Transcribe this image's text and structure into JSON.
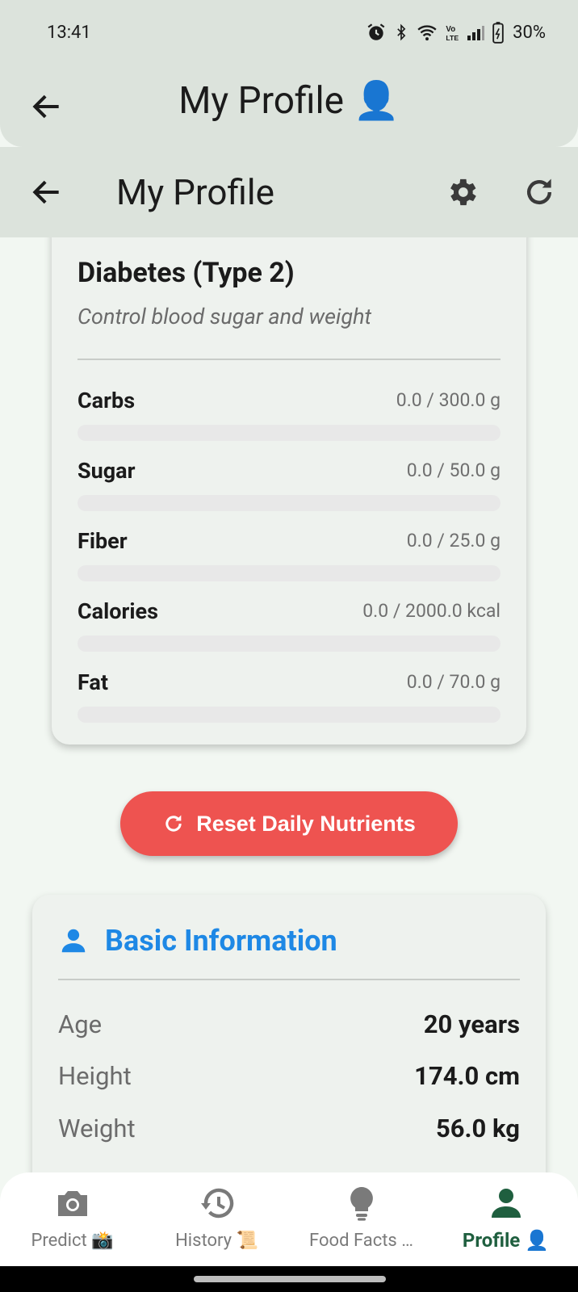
{
  "status_bar": {
    "time": "13:41",
    "battery": "30%"
  },
  "outer_appbar": {
    "title": "My Profile",
    "title_emoji": "👤"
  },
  "inner_appbar": {
    "title": "My Profile"
  },
  "condition": {
    "title": "Diabetes (Type 2)",
    "subtitle": "Control blood sugar and weight",
    "nutrients": [
      {
        "name": "Carbs",
        "value": "0.0 / 300.0 g",
        "progress": 0
      },
      {
        "name": "Sugar",
        "value": "0.0 / 50.0 g",
        "progress": 0
      },
      {
        "name": "Fiber",
        "value": "0.0 / 25.0 g",
        "progress": 0
      },
      {
        "name": "Calories",
        "value": "0.0 / 2000.0 kcal",
        "progress": 0
      },
      {
        "name": "Fat",
        "value": "0.0 / 70.0 g",
        "progress": 0
      }
    ]
  },
  "reset_button": {
    "label": "Reset Daily Nutrients"
  },
  "basic_info": {
    "title": "Basic Information",
    "rows": [
      {
        "label": "Age",
        "value": "20 years"
      },
      {
        "label": "Height",
        "value": "174.0 cm"
      },
      {
        "label": "Weight",
        "value": "56.0 kg"
      }
    ]
  },
  "bottom_nav": {
    "items": [
      {
        "label": "Predict 📸",
        "icon": "camera-icon",
        "active": false
      },
      {
        "label": "History 📜",
        "icon": "history-icon",
        "active": false
      },
      {
        "label": "Food Facts …",
        "icon": "lightbulb-icon",
        "active": false
      },
      {
        "label": "Profile 👤",
        "icon": "person-icon",
        "active": true
      }
    ]
  },
  "colors": {
    "accent": "#1e88e5",
    "reset_button": "#ee5350",
    "active_nav": "#1f5f3f",
    "appbar": "#dce3dc"
  }
}
